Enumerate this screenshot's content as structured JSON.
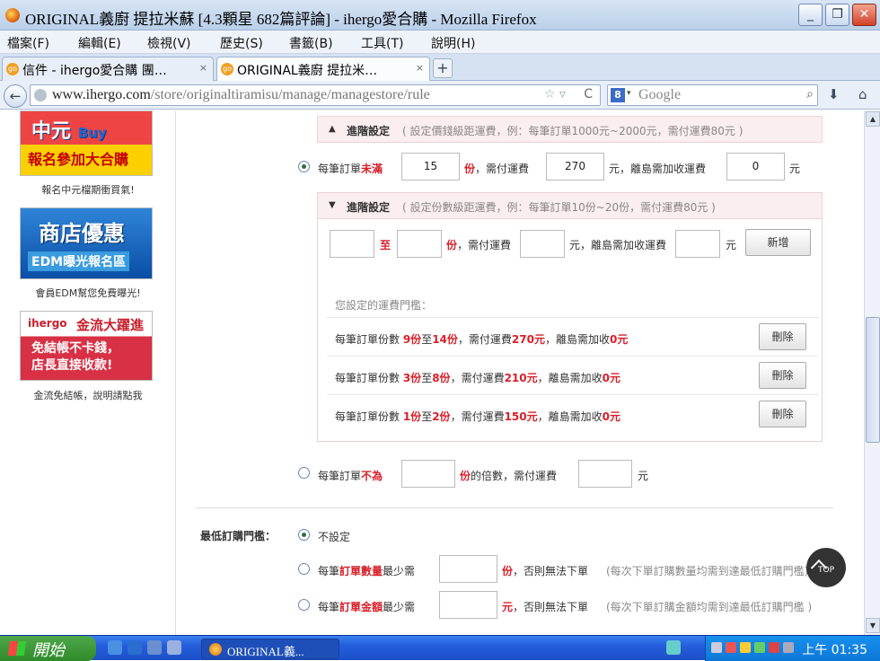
{
  "window": {
    "title": "ORIGINAL義廚 提拉米蘇 [4.3顆星 682篇評論] - ihergo愛合購 - Mozilla Firefox",
    "minimize": "_",
    "maximize": "❐",
    "close": "✕"
  },
  "menu": [
    "檔案(F)",
    "編輯(E)",
    "檢視(V)",
    "歷史(S)",
    "書籤(B)",
    "工具(T)",
    "說明(H)"
  ],
  "tabs": [
    {
      "label": "信件 - ihergo愛合購 團…",
      "icon": "go"
    },
    {
      "label": "ORIGINAL義廚 提拉米…",
      "icon": "go"
    }
  ],
  "tab_close": "×",
  "new_tab": "+",
  "nav": {
    "url_host": "www.ihergo.com",
    "url_path": "/store/originaltiramisu/manage/managestore/rule",
    "search_placeholder": "Google",
    "search_engine_icon": "8",
    "back": "←",
    "star": "☆ ▿",
    "reload": "C"
  },
  "sidebar": {
    "ads": [
      {
        "line1": "中元",
        "line1b": "Buy",
        "line2": "報名參加大合購",
        "caption": "報名中元檔期衝買氣!"
      },
      {
        "line1": "商店優惠",
        "line2": "EDM曝光報名區",
        "caption": "會員EDM幫您免費曝光!"
      },
      {
        "brand": "ihergo",
        "line1": "金流大躍進",
        "line2": "免結帳不卡錢，",
        "line3": "店長直接收款!",
        "caption": "金流免結帳，說明請點我"
      }
    ]
  },
  "advanced1": {
    "label": "進階設定",
    "hint": "( 設定價錢級距運費，例：每筆訂單1000元~2000元，需付運費80元 )"
  },
  "opt_under": {
    "prefix": "每筆訂單",
    "keyword": "未滿",
    "qty": "15",
    "unit": "份",
    "fee_label": "，需付運費",
    "fee": "270",
    "yuan": "元",
    "island_label": "，離島需加收運費",
    "island": "0",
    "yuan2": "元"
  },
  "advanced2": {
    "label": "進階設定",
    "hint": "( 設定份數級距運費，例：每筆訂單10份~20份，需付運費80元 )",
    "from_val": "",
    "to_label": "至",
    "to_val": "",
    "unit": "份",
    "fee_label": "，需付運費",
    "fee_val": "",
    "yuan": "元",
    "island_label": "，離島需加收運費",
    "island_val": "",
    "yuan2": "元",
    "add_button": "新增",
    "rules_title": "您設定的運費門檻：",
    "rules": [
      {
        "pre": "每筆訂單份數 ",
        "from": "9份",
        "mid": "至",
        "to": "14份",
        "fee_pre": "，需付運費",
        "fee": "270元",
        "island_pre": "，離島需加收",
        "island": "0元",
        "delete": "刪除"
      },
      {
        "pre": "每筆訂單份數 ",
        "from": "3份",
        "mid": "至",
        "to": "8份",
        "fee_pre": "，需付運費",
        "fee": "210元",
        "island_pre": "，離島需加收",
        "island": "0元",
        "delete": "刪除"
      },
      {
        "pre": "每筆訂單份數 ",
        "from": "1份",
        "mid": "至",
        "to": "2份",
        "fee_pre": "，需付運費",
        "fee": "150元",
        "island_pre": "，離島需加收",
        "island": "0元",
        "delete": "刪除"
      }
    ]
  },
  "opt_not": {
    "prefix": "每筆訂單",
    "keyword": "不為",
    "qty": "",
    "unit": "份",
    "suffix": "的倍數，需付運費",
    "fee": "",
    "yuan": "元"
  },
  "min_order": {
    "label": "最低訂購門檻：",
    "none": "不設定",
    "qty": {
      "prefix": "每筆",
      "keyword": "訂單數量",
      "suffix": "最少需",
      "val": "",
      "unit": "份",
      "tail": "，否則無法下單",
      "note": "(每次下單訂購數量均需到達最低訂購門檻)"
    },
    "amt": {
      "prefix": "每筆",
      "keyword": "訂單金額",
      "suffix": "最少需",
      "val": "",
      "unit": "元",
      "tail": "，否則無法下單",
      "note": "(每次下單訂購金額均需到達最低訂購門檻 )"
    }
  },
  "top_button": "TOP",
  "taskbar": {
    "start": "開始",
    "window": "ORIGINAL義...",
    "clock": "上午 01:35"
  }
}
